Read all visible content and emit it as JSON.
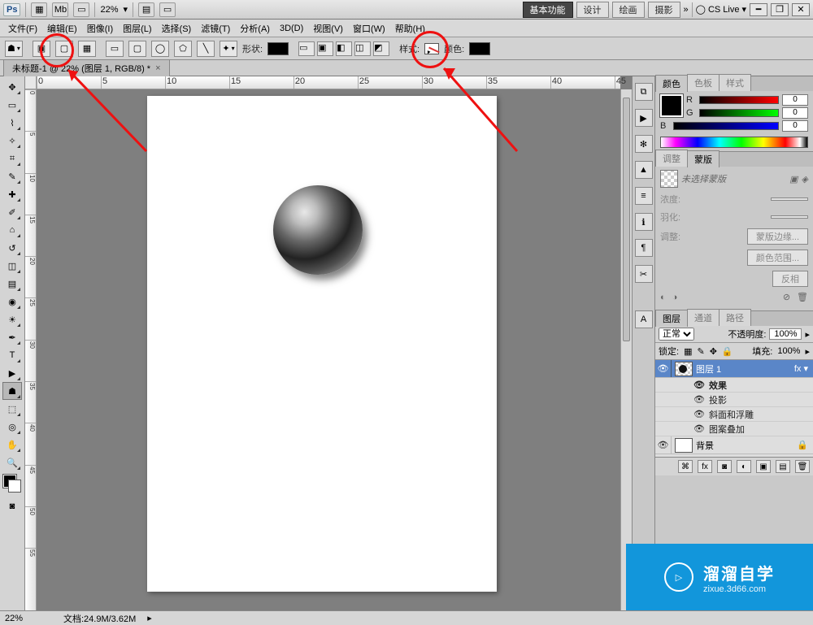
{
  "appbar": {
    "ps": "Ps",
    "zoom": "22%",
    "workspaces": [
      "基本功能",
      "设计",
      "绘画",
      "摄影"
    ],
    "cslive": "CS Live"
  },
  "menu": {
    "items": [
      "文件(F)",
      "编辑(E)",
      "图像(I)",
      "图层(L)",
      "选择(S)",
      "滤镜(T)",
      "分析(A)",
      "3D(D)",
      "视图(V)",
      "窗口(W)",
      "帮助(H)"
    ]
  },
  "opts": {
    "shape_label": "形状:",
    "style_label": "样式:",
    "color_label": "颜色:"
  },
  "doctab": {
    "title": "未标题-1 @ 22% (图层 1, RGB/8) *"
  },
  "statusbar": {
    "zoom": "22%",
    "docinfo": "文档:24.9M/3.62M"
  },
  "color_panel": {
    "tabs": [
      "颜色",
      "色板",
      "样式"
    ],
    "rgb": {
      "R": "0",
      "G": "0",
      "B": "0"
    }
  },
  "adjust_panel": {
    "tabs": [
      "调整",
      "蒙版"
    ],
    "no_mask": "未选择蒙版",
    "density_lbl": "浓度:",
    "feather_lbl": "羽化:",
    "refine_lbl": "调整:",
    "mask_edge": "蒙版边缘...",
    "color_range": "颜色范围...",
    "invert": "反相"
  },
  "layers_panel": {
    "tabs": [
      "图层",
      "通道",
      "路径"
    ],
    "blend": "正常",
    "opacity_lbl": "不透明度:",
    "opacity_val": "100%",
    "lock_lbl": "锁定:",
    "fill_lbl": "填充:",
    "fill_val": "100%",
    "layer1": "图层 1",
    "fx": "fx",
    "effects": "效果",
    "drop_shadow": "投影",
    "bevel": "斜面和浮雕",
    "pattern_overlay": "图案叠加",
    "background": "背景"
  },
  "watermark": {
    "title": "溜溜自学",
    "sub": "zixue.3d66.com"
  },
  "icons": {
    "triangle": "▸",
    "dot": "●",
    "eye": "👁",
    "arrow": "»",
    "lock": "🔒",
    "trash": "🗑"
  },
  "ruler": {
    "h": [
      "0",
      "5",
      "10",
      "15",
      "20",
      "25",
      "30",
      "35",
      "40",
      "45"
    ],
    "v": [
      "0",
      "5",
      "10",
      "15",
      "20",
      "25",
      "30",
      "35",
      "40",
      "45",
      "50",
      "55"
    ]
  }
}
